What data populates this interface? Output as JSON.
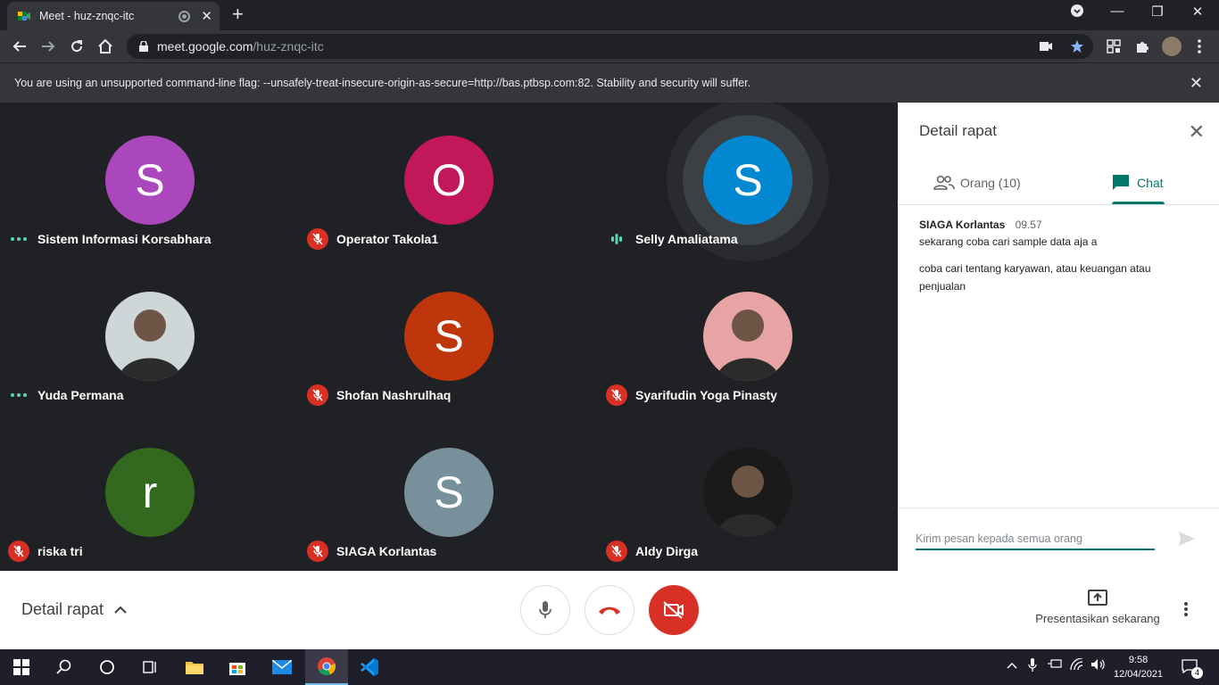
{
  "browser": {
    "tab_title": "Meet - huz-znqc-itc",
    "url_host": "meet.google.com",
    "url_path": "/huz-znqc-itc",
    "new_tab_label": "+",
    "infobar_text": "You are using an unsupported command-line flag: --unsafely-treat-insecure-origin-as-secure=http://bas.ptbsp.com:82. Stability and security will suffer."
  },
  "participants": [
    {
      "name": "Sistem Informasi Korsabhara",
      "initial": "S",
      "color": "#ab47bc",
      "status": "dots"
    },
    {
      "name": "Operator Takola1",
      "initial": "O",
      "color": "#c2185b",
      "status": "muted"
    },
    {
      "name": "Selly Amaliatama",
      "initial": "S",
      "color": "#0288d1",
      "status": "speaking"
    },
    {
      "name": "Yuda Permana",
      "initial": "",
      "color": "#cfd6d8",
      "status": "dots",
      "photo": true
    },
    {
      "name": "Shofan Nashrulhaq",
      "initial": "S",
      "color": "#bf360c",
      "status": "muted"
    },
    {
      "name": "Syarifudin Yoga Pinasty",
      "initial": "",
      "color": "#e8a4a4",
      "status": "muted",
      "photo": true
    },
    {
      "name": "riska tri",
      "initial": "r",
      "color": "#33691e",
      "status": "muted"
    },
    {
      "name": "SIAGA Korlantas",
      "initial": "S",
      "color": "#78909c",
      "status": "muted"
    },
    {
      "name": "Aldy Dirga",
      "initial": "",
      "color": "#1a1a1a",
      "status": "muted",
      "photo": true
    }
  ],
  "panel": {
    "title": "Detail rapat",
    "people_tab": "Orang (10)",
    "chat_tab": "Chat",
    "messages": {
      "sender": "SIAGA Korlantas",
      "time": "09.57",
      "line1": "sekarang coba cari sample data aja a",
      "line2": "coba cari tentang karyawan, atau keuangan atau penjualan"
    },
    "input_placeholder": "Kirim pesan kepada semua orang"
  },
  "bottom": {
    "details_label": "Detail rapat",
    "present_label": "Presentasikan sekarang"
  },
  "taskbar": {
    "time": "9:58",
    "date": "12/04/2021",
    "notifications": "4"
  },
  "colors": {
    "accent": "#00796b",
    "danger": "#d93025",
    "stage_bg": "#202124"
  }
}
